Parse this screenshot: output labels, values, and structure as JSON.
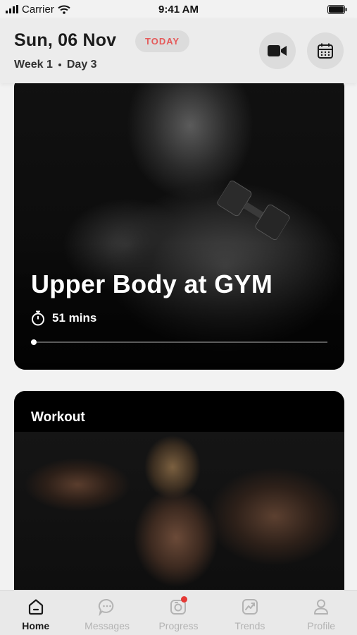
{
  "status_bar": {
    "carrier": "Carrier",
    "time": "9:41 AM"
  },
  "header": {
    "date": "Sun, 06 Nov",
    "today_badge": "TODAY",
    "week": "Week 1",
    "day": "Day 3",
    "video_icon": "video-camera-icon",
    "calendar_icon": "calendar-icon"
  },
  "hero": {
    "title": "Upper Body at GYM",
    "duration": "51 mins",
    "progress": 0.01
  },
  "workout": {
    "label": "Workout"
  },
  "tabs": [
    {
      "label": "Home",
      "icon": "home-icon",
      "active": true
    },
    {
      "label": "Messages",
      "icon": "chat-icon",
      "active": false
    },
    {
      "label": "Progress",
      "icon": "camera-progress-icon",
      "active": false,
      "badge": true
    },
    {
      "label": "Trends",
      "icon": "trend-chart-icon",
      "active": false
    },
    {
      "label": "Profile",
      "icon": "user-icon",
      "active": false
    }
  ],
  "colors": {
    "accent_red": "#e55a5a",
    "badge_red": "#e53935",
    "tab_inactive": "#b3b3b3",
    "tab_active": "#1a1a1a"
  }
}
